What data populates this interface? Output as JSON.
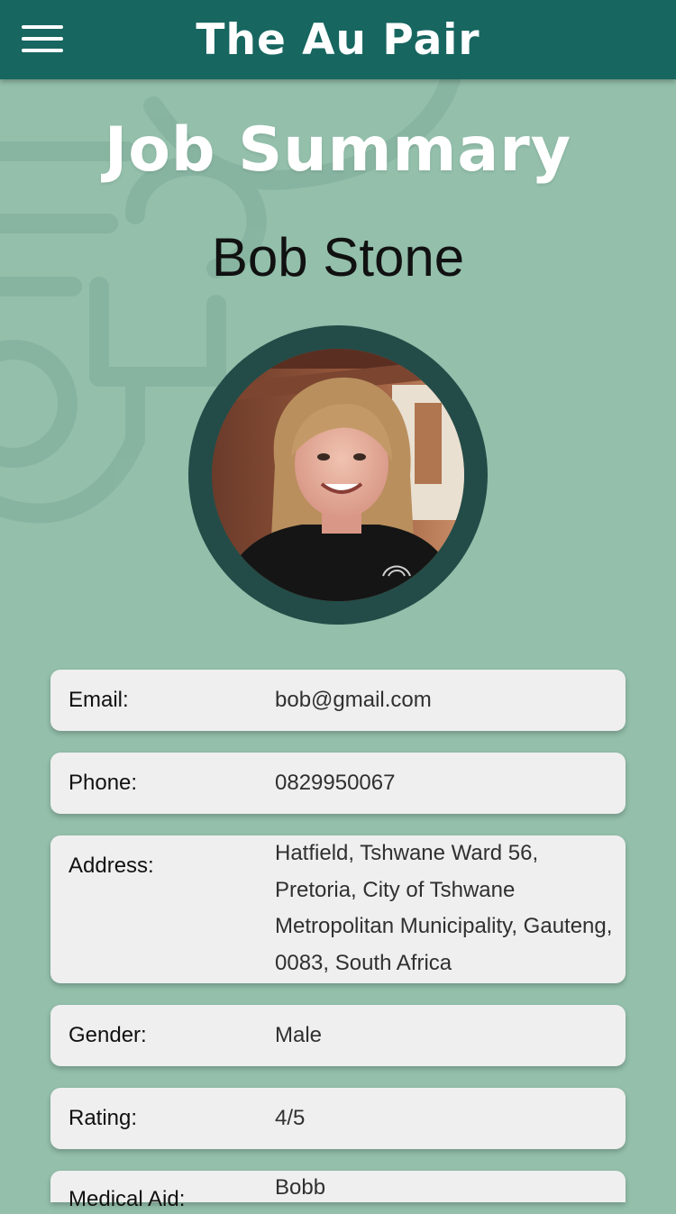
{
  "header": {
    "app_title": "The Au Pair",
    "menu_icon": "hamburger-menu-icon"
  },
  "page": {
    "title": "Job Summary",
    "person_name": "Bob Stone"
  },
  "colors": {
    "topbar": "#176660",
    "background": "#93bfab",
    "avatar_ring": "#234c48",
    "card": "#efefef"
  },
  "details": [
    {
      "label": "Email:",
      "value": "bob@gmail.com"
    },
    {
      "label": "Phone:",
      "value": "0829950067"
    },
    {
      "label": "Address:",
      "value": "Hatfield, Tshwane Ward 56, Pretoria, City of Tshwane Metropolitan Municipality, Gauteng, 0083, South Africa"
    },
    {
      "label": "Gender:",
      "value": "Male"
    },
    {
      "label": "Rating:",
      "value": "4/5"
    },
    {
      "label": "Medical Aid:",
      "value": "Bobb"
    }
  ]
}
